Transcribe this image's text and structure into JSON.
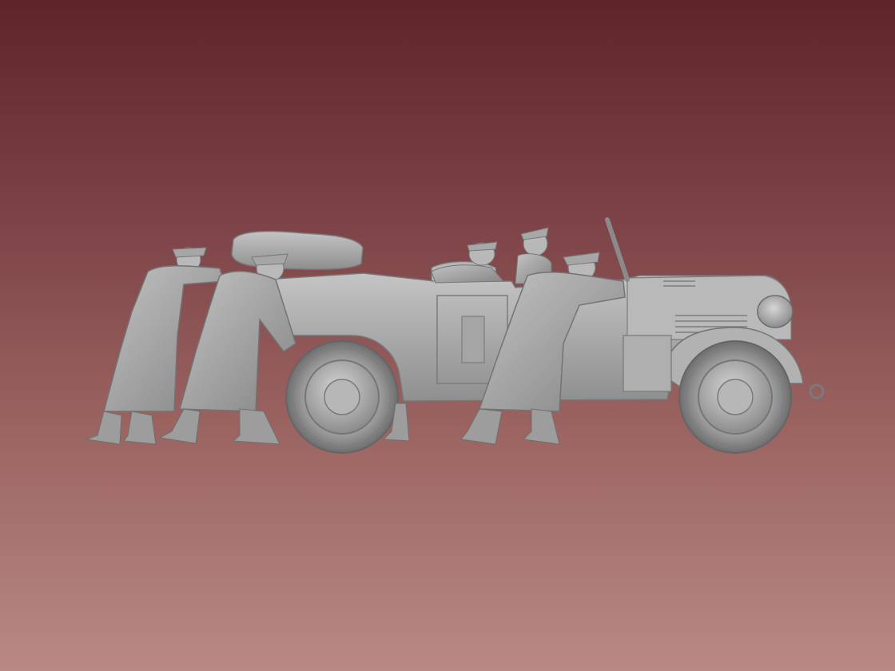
{
  "scene": {
    "subject": "3d-render",
    "background_gradient": [
      "#5e2428",
      "#7a4045",
      "#99625f",
      "#b98985"
    ],
    "model_color": "#a9a9a9",
    "model_shadow": "#6f6f6f",
    "model_highlight": "#d9d9d9"
  }
}
